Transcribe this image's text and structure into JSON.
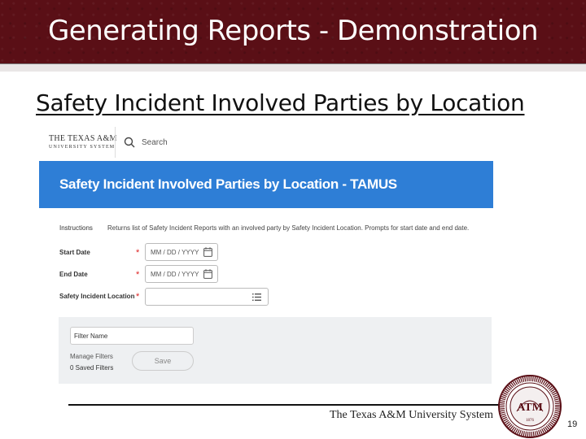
{
  "slide": {
    "title": "Generating Reports - Demonstration",
    "subtitle": "Safety Incident Involved Parties by Location",
    "page_number": "19",
    "footer_text": "The Texas A&M University System",
    "seal_letters": "ATM",
    "seal_year": "1876"
  },
  "app": {
    "logo_line1": "THE TEXAS A&M",
    "logo_line2": "UNIVERSITY SYSTEM",
    "search_placeholder": "Search",
    "header_title": "Safety Incident Involved Parties by Location - TAMUS",
    "header_color": "#2e7ed6"
  },
  "form": {
    "instructions_label": "Instructions",
    "instructions_text": "Returns list of Safety Incident Reports with an involved party by Safety Incident Location. Prompts for start date and end date.",
    "start_date_label": "Start Date",
    "start_date_placeholder": "MM / DD / YYYY",
    "end_date_label": "End Date",
    "end_date_placeholder": "MM / DD / YYYY",
    "location_label": "Safety Incident Location",
    "required_marker": "*"
  },
  "filter": {
    "name_placeholder": "Filter Name",
    "manage_label": "Manage Filters",
    "saved_filters": "0 Saved Filters",
    "save_label": "Save"
  },
  "colors": {
    "title_bar": "#5a0f16",
    "required": "#d22222"
  }
}
